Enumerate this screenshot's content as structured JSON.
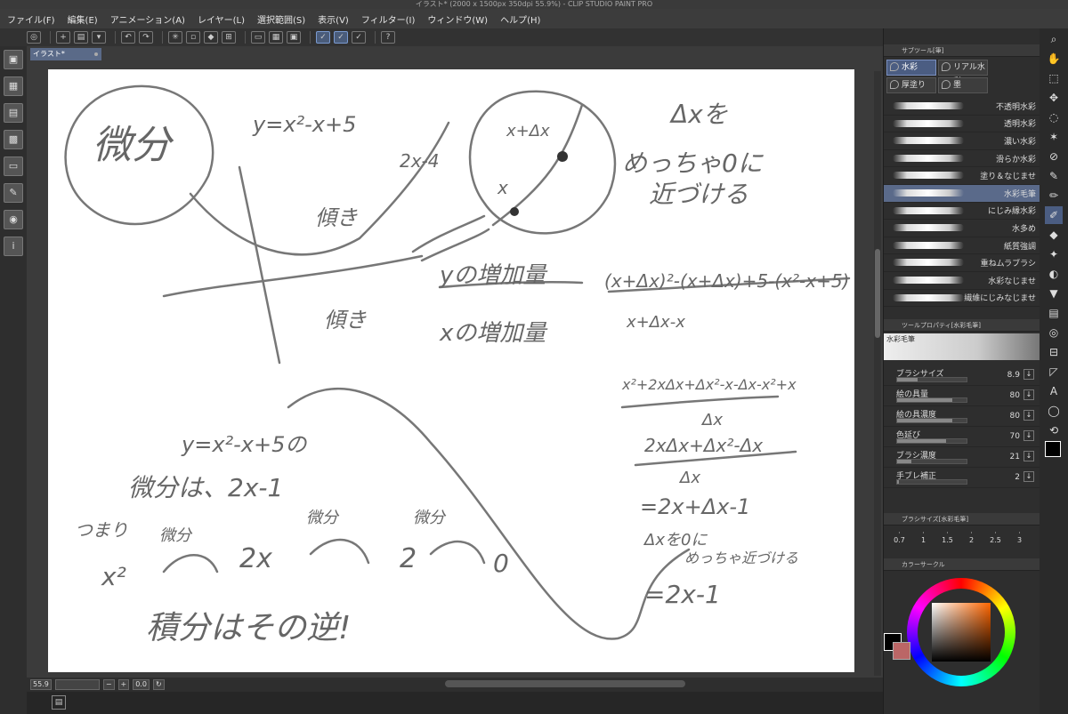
{
  "title": "イラスト* (2000 x 1500px 350dpi 55.9%) - CLIP STUDIO PAINT PRO",
  "menu": [
    "ファイル(F)",
    "編集(E)",
    "アニメーション(A)",
    "レイヤー(L)",
    "選択範囲(S)",
    "表示(V)",
    "フィルター(I)",
    "ウィンドウ(W)",
    "ヘルプ(H)"
  ],
  "canvas_tab": "イラスト*",
  "status": {
    "zoom": "55.9",
    "angle": "0.0"
  },
  "subtool_panel": {
    "title": "サブツール[筆]",
    "tabs": [
      "水彩",
      "リアル水彩",
      "厚塗り",
      "墨"
    ],
    "brushes": [
      "不透明水彩",
      "透明水彩",
      "濃い水彩",
      "滑らか水彩",
      "塗り＆なじませ",
      "水彩毛筆",
      "にじみ縁水彩",
      "水多め",
      "紙質強調",
      "重ねムラブラシ",
      "水彩なじませ",
      "繊維にじみなじませ"
    ],
    "selected_index": 5
  },
  "tool_property": {
    "title": "ツールプロパティ[水彩毛筆]",
    "brush_name": "水彩毛筆",
    "props": [
      {
        "label": "ブラシサイズ",
        "value": "8.9",
        "level": 0.3
      },
      {
        "label": "絵の具量",
        "value": "80",
        "level": 0.8
      },
      {
        "label": "絵の具濃度",
        "value": "80",
        "level": 0.8
      },
      {
        "label": "色延び",
        "value": "70",
        "level": 0.7
      },
      {
        "label": "ブラシ濃度",
        "value": "21",
        "level": 0.21
      },
      {
        "label": "手ブレ補正",
        "value": "2",
        "level": 0.02
      }
    ]
  },
  "brush_size_panel": {
    "title": "ブラシサイズ[水彩毛筆]",
    "sizes": [
      "0.7",
      "1",
      "1.5",
      "2",
      "2.5",
      "3"
    ]
  },
  "color_panel": {
    "title": "カラーサークル"
  },
  "handwriting": {
    "t1": "微分",
    "t2": "y=x²-x+5",
    "t3": "2x-4",
    "t4": "x+Δx",
    "t5": "x",
    "t6": "Δxを",
    "t7": "めっちゃ0に",
    "t8": "近づける",
    "t9": "傾き",
    "t10": "yの増加量",
    "t11": "傾き",
    "t12": "xの増加量",
    "t13": "(x+Δx)²-(x+Δx)+5-(x²-x+5)",
    "t14": "x+Δx-x",
    "t15": "x²+2xΔx+Δx²-x-Δx-x²+x",
    "t16": "Δx",
    "t17": "2xΔx+Δx²-Δx",
    "t18": "Δx",
    "t19": "=2x+Δx-1",
    "t20": "Δxを0に",
    "t21": "めっちゃ近づける",
    "t22": "=2x-1",
    "t23": "y=x²-x+5の",
    "t24": "微分は、2x-1",
    "t25": "つまり",
    "t26": "x²",
    "t27": "2x",
    "t28": "2",
    "t29": "0",
    "t30": "微分",
    "t31": "微分",
    "t32": "微分",
    "t33": "積分はその逆!"
  }
}
